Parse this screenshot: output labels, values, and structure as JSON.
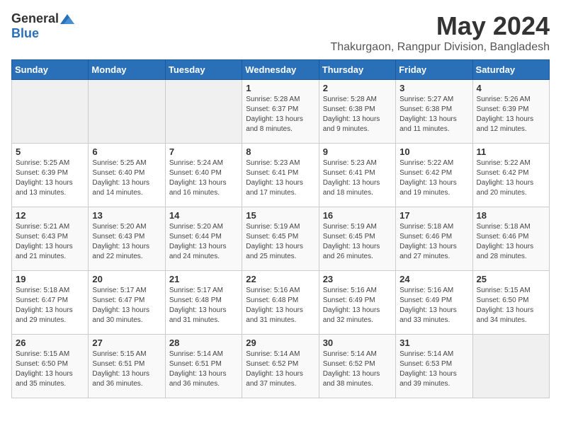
{
  "logo": {
    "general": "General",
    "blue": "Blue"
  },
  "title": "May 2024",
  "subtitle": "Thakurgaon, Rangpur Division, Bangladesh",
  "headers": [
    "Sunday",
    "Monday",
    "Tuesday",
    "Wednesday",
    "Thursday",
    "Friday",
    "Saturday"
  ],
  "weeks": [
    [
      {
        "day": "",
        "info": ""
      },
      {
        "day": "",
        "info": ""
      },
      {
        "day": "",
        "info": ""
      },
      {
        "day": "1",
        "info": "Sunrise: 5:28 AM\nSunset: 6:37 PM\nDaylight: 13 hours\nand 8 minutes."
      },
      {
        "day": "2",
        "info": "Sunrise: 5:28 AM\nSunset: 6:38 PM\nDaylight: 13 hours\nand 9 minutes."
      },
      {
        "day": "3",
        "info": "Sunrise: 5:27 AM\nSunset: 6:38 PM\nDaylight: 13 hours\nand 11 minutes."
      },
      {
        "day": "4",
        "info": "Sunrise: 5:26 AM\nSunset: 6:39 PM\nDaylight: 13 hours\nand 12 minutes."
      }
    ],
    [
      {
        "day": "5",
        "info": "Sunrise: 5:25 AM\nSunset: 6:39 PM\nDaylight: 13 hours\nand 13 minutes."
      },
      {
        "day": "6",
        "info": "Sunrise: 5:25 AM\nSunset: 6:40 PM\nDaylight: 13 hours\nand 14 minutes."
      },
      {
        "day": "7",
        "info": "Sunrise: 5:24 AM\nSunset: 6:40 PM\nDaylight: 13 hours\nand 16 minutes."
      },
      {
        "day": "8",
        "info": "Sunrise: 5:23 AM\nSunset: 6:41 PM\nDaylight: 13 hours\nand 17 minutes."
      },
      {
        "day": "9",
        "info": "Sunrise: 5:23 AM\nSunset: 6:41 PM\nDaylight: 13 hours\nand 18 minutes."
      },
      {
        "day": "10",
        "info": "Sunrise: 5:22 AM\nSunset: 6:42 PM\nDaylight: 13 hours\nand 19 minutes."
      },
      {
        "day": "11",
        "info": "Sunrise: 5:22 AM\nSunset: 6:42 PM\nDaylight: 13 hours\nand 20 minutes."
      }
    ],
    [
      {
        "day": "12",
        "info": "Sunrise: 5:21 AM\nSunset: 6:43 PM\nDaylight: 13 hours\nand 21 minutes."
      },
      {
        "day": "13",
        "info": "Sunrise: 5:20 AM\nSunset: 6:43 PM\nDaylight: 13 hours\nand 22 minutes."
      },
      {
        "day": "14",
        "info": "Sunrise: 5:20 AM\nSunset: 6:44 PM\nDaylight: 13 hours\nand 24 minutes."
      },
      {
        "day": "15",
        "info": "Sunrise: 5:19 AM\nSunset: 6:45 PM\nDaylight: 13 hours\nand 25 minutes."
      },
      {
        "day": "16",
        "info": "Sunrise: 5:19 AM\nSunset: 6:45 PM\nDaylight: 13 hours\nand 26 minutes."
      },
      {
        "day": "17",
        "info": "Sunrise: 5:18 AM\nSunset: 6:46 PM\nDaylight: 13 hours\nand 27 minutes."
      },
      {
        "day": "18",
        "info": "Sunrise: 5:18 AM\nSunset: 6:46 PM\nDaylight: 13 hours\nand 28 minutes."
      }
    ],
    [
      {
        "day": "19",
        "info": "Sunrise: 5:18 AM\nSunset: 6:47 PM\nDaylight: 13 hours\nand 29 minutes."
      },
      {
        "day": "20",
        "info": "Sunrise: 5:17 AM\nSunset: 6:47 PM\nDaylight: 13 hours\nand 30 minutes."
      },
      {
        "day": "21",
        "info": "Sunrise: 5:17 AM\nSunset: 6:48 PM\nDaylight: 13 hours\nand 31 minutes."
      },
      {
        "day": "22",
        "info": "Sunrise: 5:16 AM\nSunset: 6:48 PM\nDaylight: 13 hours\nand 31 minutes."
      },
      {
        "day": "23",
        "info": "Sunrise: 5:16 AM\nSunset: 6:49 PM\nDaylight: 13 hours\nand 32 minutes."
      },
      {
        "day": "24",
        "info": "Sunrise: 5:16 AM\nSunset: 6:49 PM\nDaylight: 13 hours\nand 33 minutes."
      },
      {
        "day": "25",
        "info": "Sunrise: 5:15 AM\nSunset: 6:50 PM\nDaylight: 13 hours\nand 34 minutes."
      }
    ],
    [
      {
        "day": "26",
        "info": "Sunrise: 5:15 AM\nSunset: 6:50 PM\nDaylight: 13 hours\nand 35 minutes."
      },
      {
        "day": "27",
        "info": "Sunrise: 5:15 AM\nSunset: 6:51 PM\nDaylight: 13 hours\nand 36 minutes."
      },
      {
        "day": "28",
        "info": "Sunrise: 5:14 AM\nSunset: 6:51 PM\nDaylight: 13 hours\nand 36 minutes."
      },
      {
        "day": "29",
        "info": "Sunrise: 5:14 AM\nSunset: 6:52 PM\nDaylight: 13 hours\nand 37 minutes."
      },
      {
        "day": "30",
        "info": "Sunrise: 5:14 AM\nSunset: 6:52 PM\nDaylight: 13 hours\nand 38 minutes."
      },
      {
        "day": "31",
        "info": "Sunrise: 5:14 AM\nSunset: 6:53 PM\nDaylight: 13 hours\nand 39 minutes."
      },
      {
        "day": "",
        "info": ""
      }
    ]
  ]
}
